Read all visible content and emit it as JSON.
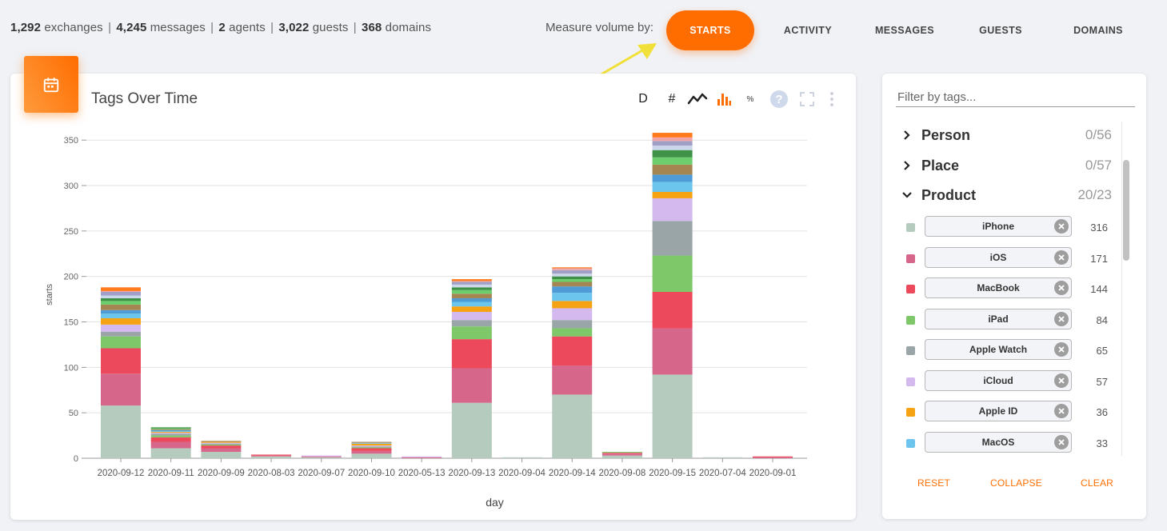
{
  "stats": [
    {
      "value": "1,292",
      "label": "exchanges"
    },
    {
      "value": "4,245",
      "label": "messages"
    },
    {
      "value": "2",
      "label": "agents"
    },
    {
      "value": "3,022",
      "label": "guests"
    },
    {
      "value": "368",
      "label": "domains"
    }
  ],
  "stats_separator": "|",
  "measure": {
    "label": "Measure volume by:",
    "options": [
      "STARTS",
      "ACTIVITY",
      "MESSAGES",
      "GUESTS",
      "DOMAINS"
    ],
    "selected": "STARTS"
  },
  "chart_card": {
    "title": "Tags Over Time",
    "toolbar": {
      "d": "D",
      "hash": "#",
      "pct": "%"
    },
    "icons": [
      "calendar-icon",
      "line-chart-icon",
      "bar-chart-icon",
      "help-icon",
      "fullscreen-icon",
      "more-vert-icon"
    ]
  },
  "chart_data": {
    "type": "bar",
    "stacked": true,
    "title": "Tags Over Time",
    "xlabel": "day",
    "ylabel": "starts",
    "ylim": [
      0,
      365
    ],
    "yticks": [
      0,
      50,
      100,
      150,
      200,
      250,
      300,
      350
    ],
    "grid": true,
    "categories": [
      "2020-09-12",
      "2020-09-11",
      "2020-09-09",
      "2020-08-03",
      "2020-09-07",
      "2020-09-10",
      "2020-05-13",
      "2020-09-13",
      "2020-09-04",
      "2020-09-14",
      "2020-09-08",
      "2020-09-15",
      "2020-07-04",
      "2020-09-01"
    ],
    "series": [
      {
        "name": "iPhone",
        "color": "#b5cbbd",
        "values": [
          58,
          11,
          7,
          2,
          1,
          5,
          0,
          61,
          1,
          70,
          3,
          92,
          1,
          0
        ]
      },
      {
        "name": "iOS",
        "color": "#d6668a",
        "values": [
          35,
          7,
          4,
          1,
          1,
          3,
          1,
          38,
          0,
          32,
          2,
          51,
          0,
          1
        ]
      },
      {
        "name": "MacBook",
        "color": "#ec4a5c",
        "values": [
          28,
          5,
          3,
          1,
          0,
          3,
          0,
          32,
          0,
          32,
          1,
          40,
          0,
          1
        ]
      },
      {
        "name": "iPad",
        "color": "#7ec86a",
        "values": [
          13,
          2,
          1,
          0,
          0,
          1,
          0,
          14,
          0,
          9,
          1,
          40,
          0,
          0
        ]
      },
      {
        "name": "Apple Watch",
        "color": "#9aa5a7",
        "values": [
          5,
          2,
          1,
          0,
          0,
          1,
          0,
          7,
          0,
          9,
          0,
          38,
          0,
          0
        ]
      },
      {
        "name": "iCloud",
        "color": "#d4b9ee",
        "values": [
          8,
          1,
          1,
          0,
          1,
          1,
          1,
          9,
          0,
          13,
          0,
          25,
          0,
          0
        ]
      },
      {
        "name": "Apple ID",
        "color": "#f5a312",
        "values": [
          7,
          1,
          1,
          0,
          0,
          2,
          0,
          6,
          0,
          8,
          0,
          7,
          0,
          0
        ]
      },
      {
        "name": "MacOS",
        "color": "#6cc5ec",
        "values": [
          5,
          1,
          0,
          0,
          0,
          1,
          0,
          5,
          0,
          9,
          0,
          11,
          0,
          0
        ]
      },
      {
        "name": "",
        "color": "#4e9bd6",
        "values": [
          4,
          1,
          0,
          0,
          0,
          0,
          0,
          4,
          0,
          7,
          0,
          8,
          0,
          0
        ]
      },
      {
        "name": "",
        "color": "#a58552",
        "values": [
          6,
          1,
          1,
          0,
          0,
          1,
          0,
          5,
          0,
          5,
          0,
          11,
          0,
          0
        ]
      },
      {
        "name": "",
        "color": "#6cce6c",
        "values": [
          4,
          1,
          0,
          0,
          0,
          0,
          0,
          4,
          0,
          3,
          0,
          8,
          0,
          0
        ]
      },
      {
        "name": "",
        "color": "#3f9148",
        "values": [
          3,
          1,
          0,
          0,
          0,
          0,
          0,
          3,
          0,
          3,
          0,
          8,
          0,
          0
        ]
      },
      {
        "name": "",
        "color": "#cbd6ea",
        "values": [
          3,
          0,
          0,
          0,
          0,
          0,
          0,
          3,
          0,
          3,
          0,
          5,
          0,
          0
        ]
      },
      {
        "name": "",
        "color": "#a0a0c6",
        "values": [
          4,
          0,
          0,
          0,
          0,
          0,
          0,
          3,
          0,
          4,
          0,
          5,
          0,
          0
        ]
      },
      {
        "name": "",
        "color": "#f2a3a3",
        "values": [
          1,
          0,
          0,
          0,
          0,
          0,
          0,
          1,
          0,
          2,
          0,
          4,
          0,
          0
        ]
      },
      {
        "name": "",
        "color": "#ff7a1a",
        "values": [
          4,
          0,
          0,
          0,
          0,
          0,
          0,
          2,
          0,
          1,
          0,
          5,
          0,
          0
        ]
      }
    ]
  },
  "tags_panel": {
    "filter_placeholder": "Filter by tags...",
    "groups": [
      {
        "name": "Person",
        "count": "0/56",
        "expanded": false
      },
      {
        "name": "Place",
        "count": "0/57",
        "expanded": false
      },
      {
        "name": "Product",
        "count": "20/23",
        "expanded": true
      }
    ],
    "tags": [
      {
        "label": "iPhone",
        "count": "316",
        "color": "#b5cbbd"
      },
      {
        "label": "iOS",
        "count": "171",
        "color": "#d6668a"
      },
      {
        "label": "MacBook",
        "count": "144",
        "color": "#ec4a5c"
      },
      {
        "label": "iPad",
        "count": "84",
        "color": "#7ec86a"
      },
      {
        "label": "Apple Watch",
        "count": "65",
        "color": "#9aa5a7"
      },
      {
        "label": "iCloud",
        "count": "57",
        "color": "#d4b9ee"
      },
      {
        "label": "Apple ID",
        "count": "36",
        "color": "#f5a312"
      },
      {
        "label": "MacOS",
        "count": "33",
        "color": "#6cc5ec"
      }
    ],
    "footer": {
      "reset": "RESET",
      "collapse": "COLLAPSE",
      "clear": "CLEAR"
    }
  },
  "colors": {
    "accent": "#ff6d00",
    "highlight_arrow": "#f2e03a"
  }
}
